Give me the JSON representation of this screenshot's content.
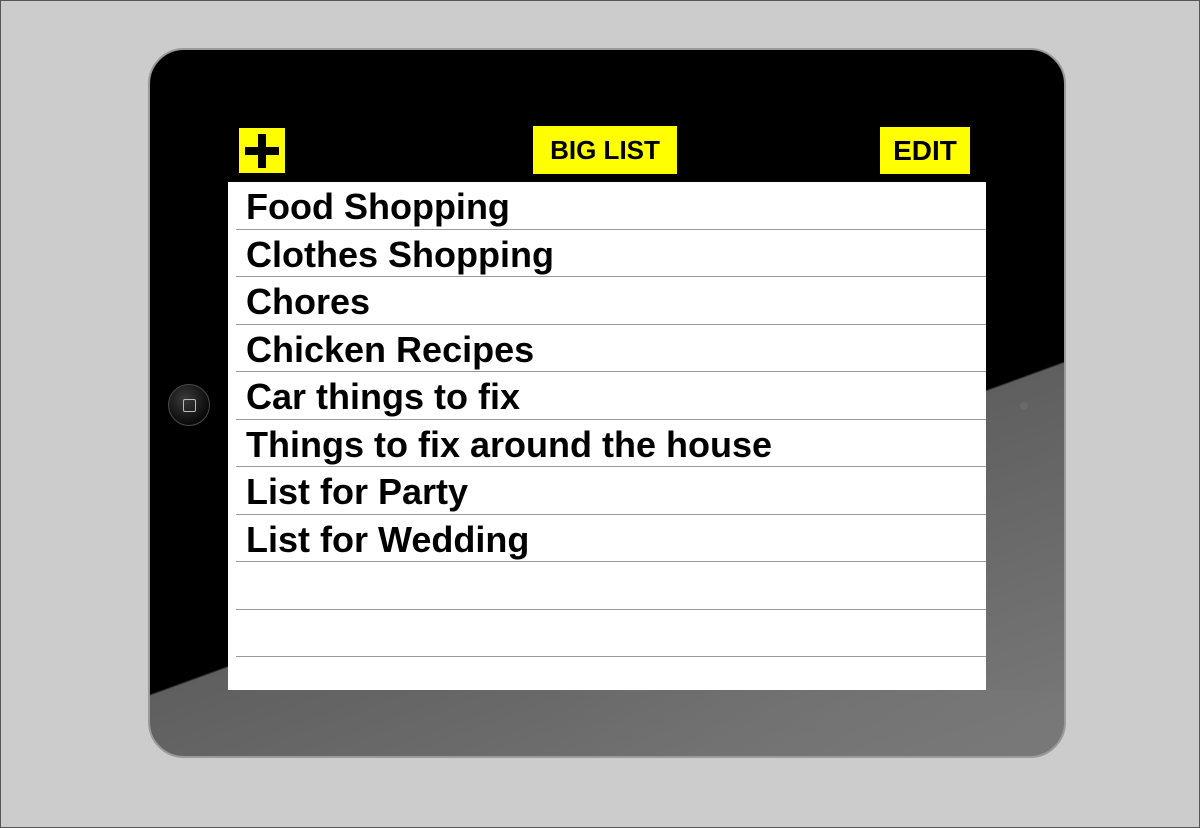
{
  "header": {
    "add_icon": "plus-icon",
    "title": "BIG LIST",
    "edit_label": "EDIT"
  },
  "lists": [
    {
      "label": "Food Shopping"
    },
    {
      "label": "Clothes Shopping"
    },
    {
      "label": "Chores"
    },
    {
      "label": "Chicken Recipes"
    },
    {
      "label": "Car things to fix"
    },
    {
      "label": "Things to fix around the house"
    },
    {
      "label": "List for Party"
    },
    {
      "label": "List for Wedding"
    },
    {
      "label": ""
    },
    {
      "label": ""
    },
    {
      "label": ""
    }
  ],
  "colors": {
    "accent": "#ffff00",
    "nav_background": "#000000",
    "screen_background": "#ffffff",
    "canvas_background": "#cccccc"
  }
}
